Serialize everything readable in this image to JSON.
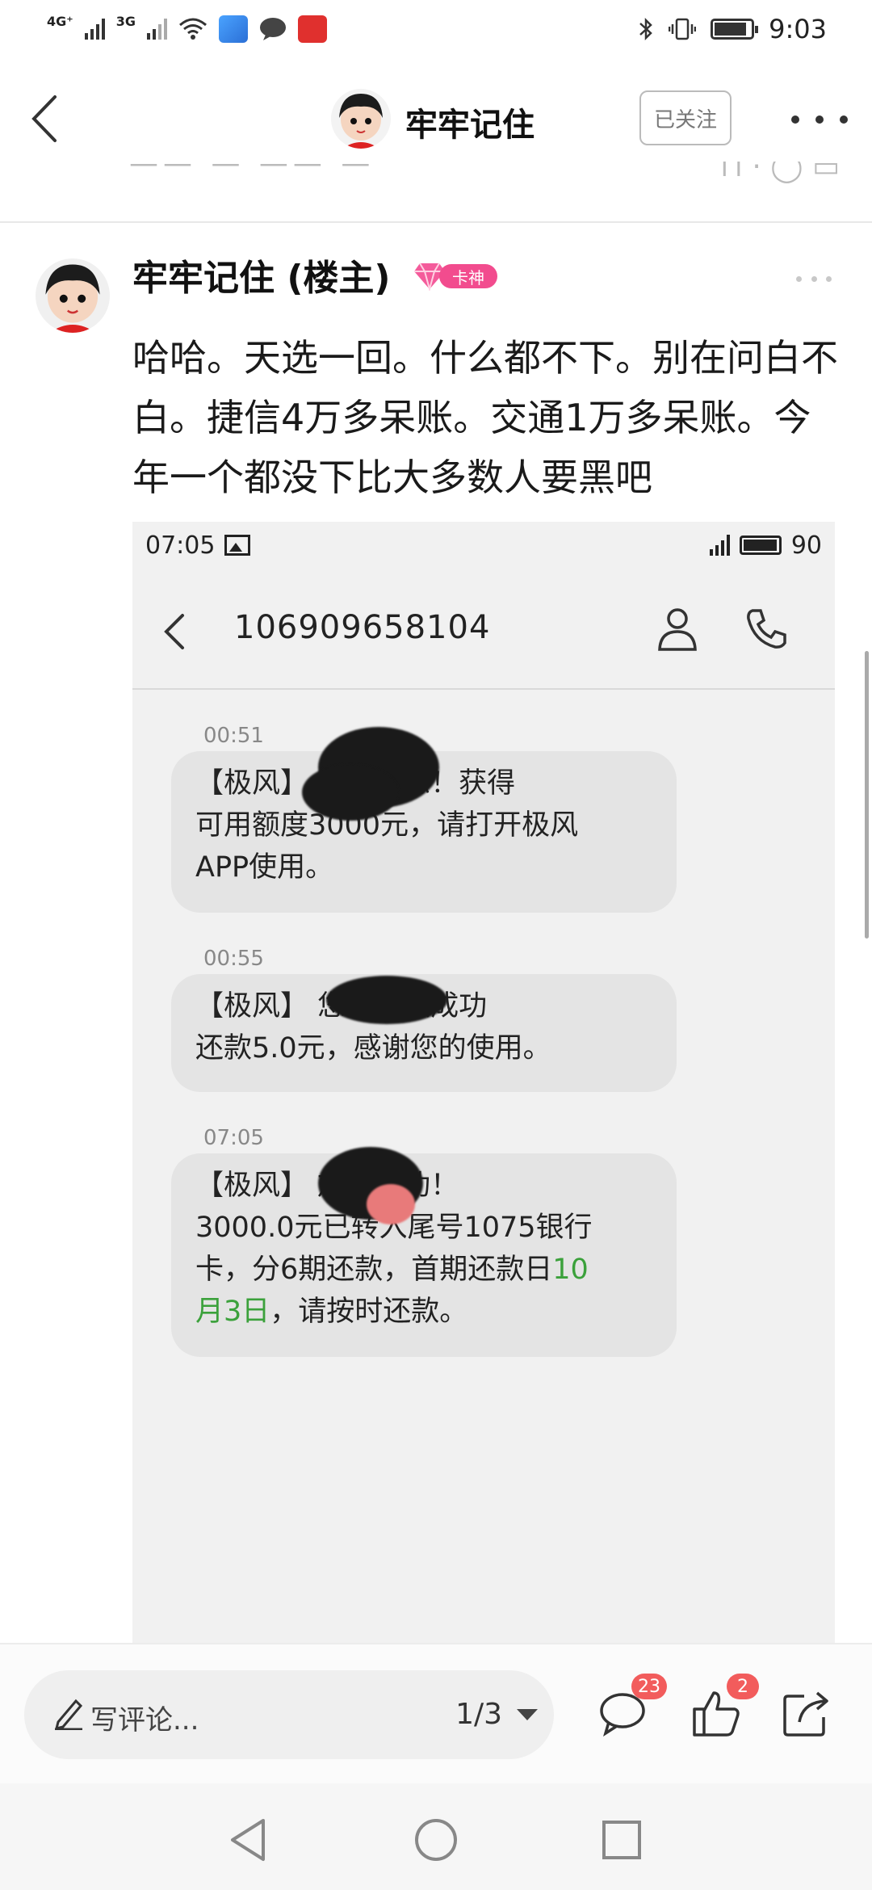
{
  "status_bar": {
    "signal1_label": "4G⁺",
    "signal2_label": "3G",
    "time": "9:03"
  },
  "nav": {
    "title": "牢牢记住",
    "follow_label": "已关注"
  },
  "post": {
    "author": "牢牢记住 (楼主)",
    "badge": "卡神",
    "text": "哈哈。天选一回。什么都不下。别在问白不白。捷信4万多呆账。交通1万多呆账。今年一个都没下比大多数人要黑吧"
  },
  "screenshot": {
    "time": "07:05",
    "battery": "90",
    "sender": "106909658104",
    "messages": [
      {
        "time": "00:51",
        "line1": "【极风】  ：恭喜您！获得",
        "line2": "可用额度3000元，请打开极风",
        "line3": "APP使用。"
      },
      {
        "time": "00:55",
        "line1": "【极风】  您的玩呗成功",
        "line2": "还款5.0元，感谢您的使用。"
      },
      {
        "time": "07:05",
        "line1": "【极风】  放款成功！",
        "line2": "3000.0元已转入尾号1075银行",
        "line3a": "卡，分6期还款，首期还款日",
        "line3b": "10",
        "line4a": "月3日",
        "line4b": "，请按时还款。"
      }
    ]
  },
  "bottom_bar": {
    "comment_placeholder": "写评论...",
    "page_indicator": "1/3",
    "comment_count": "23",
    "like_count": "2"
  },
  "icons": {
    "back": "chevron-left-icon",
    "more": "more-dots-icon",
    "comment": "comment-bubble-icon",
    "like": "thumbs-up-icon",
    "share": "share-icon"
  }
}
